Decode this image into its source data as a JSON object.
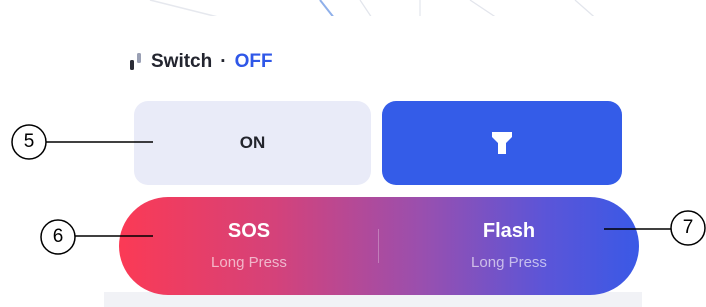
{
  "switch": {
    "label": "Switch",
    "separator": "·",
    "state": "OFF"
  },
  "controls": {
    "on_label": "ON",
    "torch_icon": "flashlight-icon"
  },
  "modes": {
    "sos": {
      "title": "SOS",
      "subtitle": "Long Press"
    },
    "flash": {
      "title": "Flash",
      "subtitle": "Long Press"
    }
  },
  "callouts": {
    "c5": "5",
    "c6": "6",
    "c7": "7"
  },
  "colors": {
    "accent": "#345ce8",
    "state_text": "#2f57e8",
    "on_button_bg": "#e9ebf8",
    "gradient_start": "#fb3a55",
    "gradient_end": "#3a59e6"
  }
}
